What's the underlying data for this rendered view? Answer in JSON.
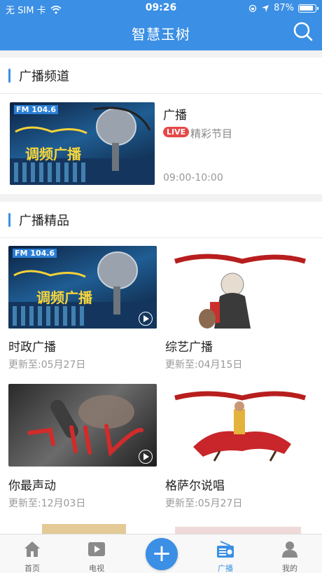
{
  "status": {
    "carrier": "无 SIM 卡",
    "time": "09:26",
    "battery": "87%"
  },
  "header": {
    "title": "智慧玉树"
  },
  "section_channels": {
    "title": "广播频道"
  },
  "channel": {
    "name": "广播",
    "live_badge": "LIVE",
    "subtitle": "精彩节目",
    "time": "09:00-10:00",
    "thumb_caption": "调频广播",
    "thumb_tag": "FM 104.6"
  },
  "section_featured": {
    "title": "广播精品"
  },
  "cards": [
    {
      "title": "时政广播",
      "updated": "更新至:05月27日",
      "thumb_caption": "调频广播",
      "thumb_tag": "FM 104.6"
    },
    {
      "title": "综艺广播",
      "updated": "更新至:04月15日"
    },
    {
      "title": "你最声动",
      "updated": "更新至:12月03日"
    },
    {
      "title": "格萨尔说唱",
      "updated": "更新至:05月27日"
    }
  ],
  "tabs": [
    {
      "label": "首页"
    },
    {
      "label": "电视"
    },
    {
      "label": "广播"
    },
    {
      "label": "我的"
    }
  ],
  "plus_label": "+",
  "colors": {
    "accent": "#3b8fe4",
    "live": "#e54848"
  }
}
